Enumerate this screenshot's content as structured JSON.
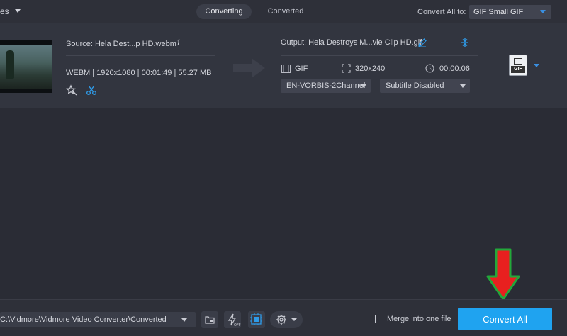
{
  "topbar": {
    "files_label": "es",
    "tabs": [
      {
        "label": "Converting",
        "active": true
      },
      {
        "label": "Converted",
        "active": false
      }
    ],
    "convert_all_to_label": "Convert All to:",
    "convert_all_to_value": "GIF Small GIF"
  },
  "file": {
    "source": "Source: Hela Dest...p HD.webm",
    "meta": "WEBM | 1920x1080 | 00:01:49 | 55.27 MB",
    "output": "Output: Hela Destroys M...vie Clip HD.gif",
    "format": "GIF",
    "resolution": "320x240",
    "duration": "00:00:06",
    "audio_track": "EN-VORBIS-2Channel",
    "subtitle": "Subtitle Disabled",
    "profile_label": "GIF"
  },
  "bottombar": {
    "save_path": "C:\\Vidmore\\Vidmore Video Converter\\Converted",
    "merge_label": "Merge into one file",
    "merge_checked": false,
    "convert_button": "Convert All"
  },
  "colors": {
    "accent": "#1fa3f0",
    "annotation_arrow_fill": "#e8201f",
    "annotation_arrow_stroke": "#22a83a"
  },
  "icons": [
    "info-icon",
    "magic-star-icon",
    "scissors-icon",
    "edit-pencil-icon",
    "compress-icon",
    "film-icon",
    "resize-icon",
    "clock-icon",
    "folder-icon",
    "hardware-accel-icon",
    "gpu-icon",
    "gear-icon"
  ]
}
